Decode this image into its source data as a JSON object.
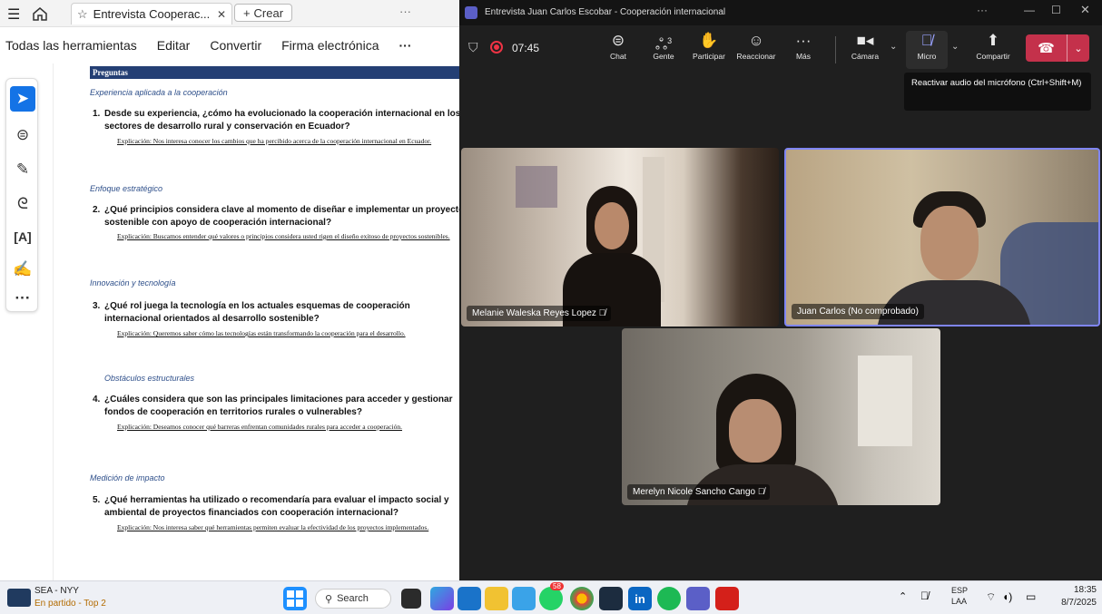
{
  "pdf": {
    "tab_title": "Entrevista Cooperac...",
    "new_tab": "Crear",
    "menu": [
      "Todas las herramientas",
      "Editar",
      "Convertir",
      "Firma electrónica"
    ],
    "doc_header": "Preguntas",
    "sections": [
      {
        "title": "Experiencia aplicada a la cooperación",
        "num": "1.",
        "question": "Desde su experiencia, ¿cómo ha evolucionado la cooperación internacional en los sectores de desarrollo rural y conservación en Ecuador?",
        "explanation": "Explicación: Nos interesa conocer los cambios que ha percibido acerca de la cooperación internacional en Ecuador."
      },
      {
        "title": "Enfoque estratégico",
        "num": "2.",
        "question": "¿Qué principios considera clave al momento de diseñar e implementar un proyecto sostenible con apoyo de cooperación internacional?",
        "explanation": "Explicación: Buscamos entender qué valores o principios considera usted rigen el diseño exitoso de proyectos sostenibles."
      },
      {
        "title": "Innovación y tecnología",
        "num": "3.",
        "question": "¿Qué rol juega la tecnología en los actuales esquemas de cooperación internacional orientados al desarrollo sostenible?",
        "explanation": "Explicación: Queremos saber cómo las tecnologías están transformando la cooperación para el desarrollo."
      },
      {
        "title": "Obstáculos estructurales",
        "num": "4.",
        "question": "¿Cuáles considera que son las principales limitaciones para acceder y gestionar fondos de cooperación en territorios rurales o vulnerables?",
        "explanation": "Explicación: Deseamos conocer qué barreras enfrentan comunidades rurales para acceder a cooperación."
      },
      {
        "title": "Medición de impacto",
        "num": "5.",
        "question": "¿Qué herramientas ha utilizado o recomendaría para evaluar el impacto social y ambiental de proyectos financiados con cooperación internacional?",
        "explanation": "Explicación: Nos interesa saber qué herramientas permiten evaluar la efectividad de los proyectos implementados."
      }
    ]
  },
  "teams": {
    "window_title": "Entrevista Juan Carlos Escobar - Cooperación internacional",
    "timer": "07:45",
    "buttons": {
      "chat": "Chat",
      "people": "Gente",
      "people_count": "3",
      "raise": "Participar",
      "react": "Reaccionar",
      "more": "Más",
      "camera": "Cámara",
      "mic": "Micro",
      "share": "Compartir"
    },
    "tooltip": "Reactivar audio del micrófono (Ctrl+Shift+M)",
    "participants": [
      {
        "name": "Melanie Waleska Reyes Lopez"
      },
      {
        "name": "Juan Carlos (No comprobado)"
      },
      {
        "name": "Merelyn Nicole Sancho Cango"
      }
    ]
  },
  "taskbar": {
    "weather_title": "SEA - NYY",
    "weather_sub": "En partido - Top 2",
    "search": "Search",
    "badge": "58",
    "lang1": "ESP",
    "lang2": "LAA",
    "time": "18:35",
    "date": "8/7/2025"
  }
}
